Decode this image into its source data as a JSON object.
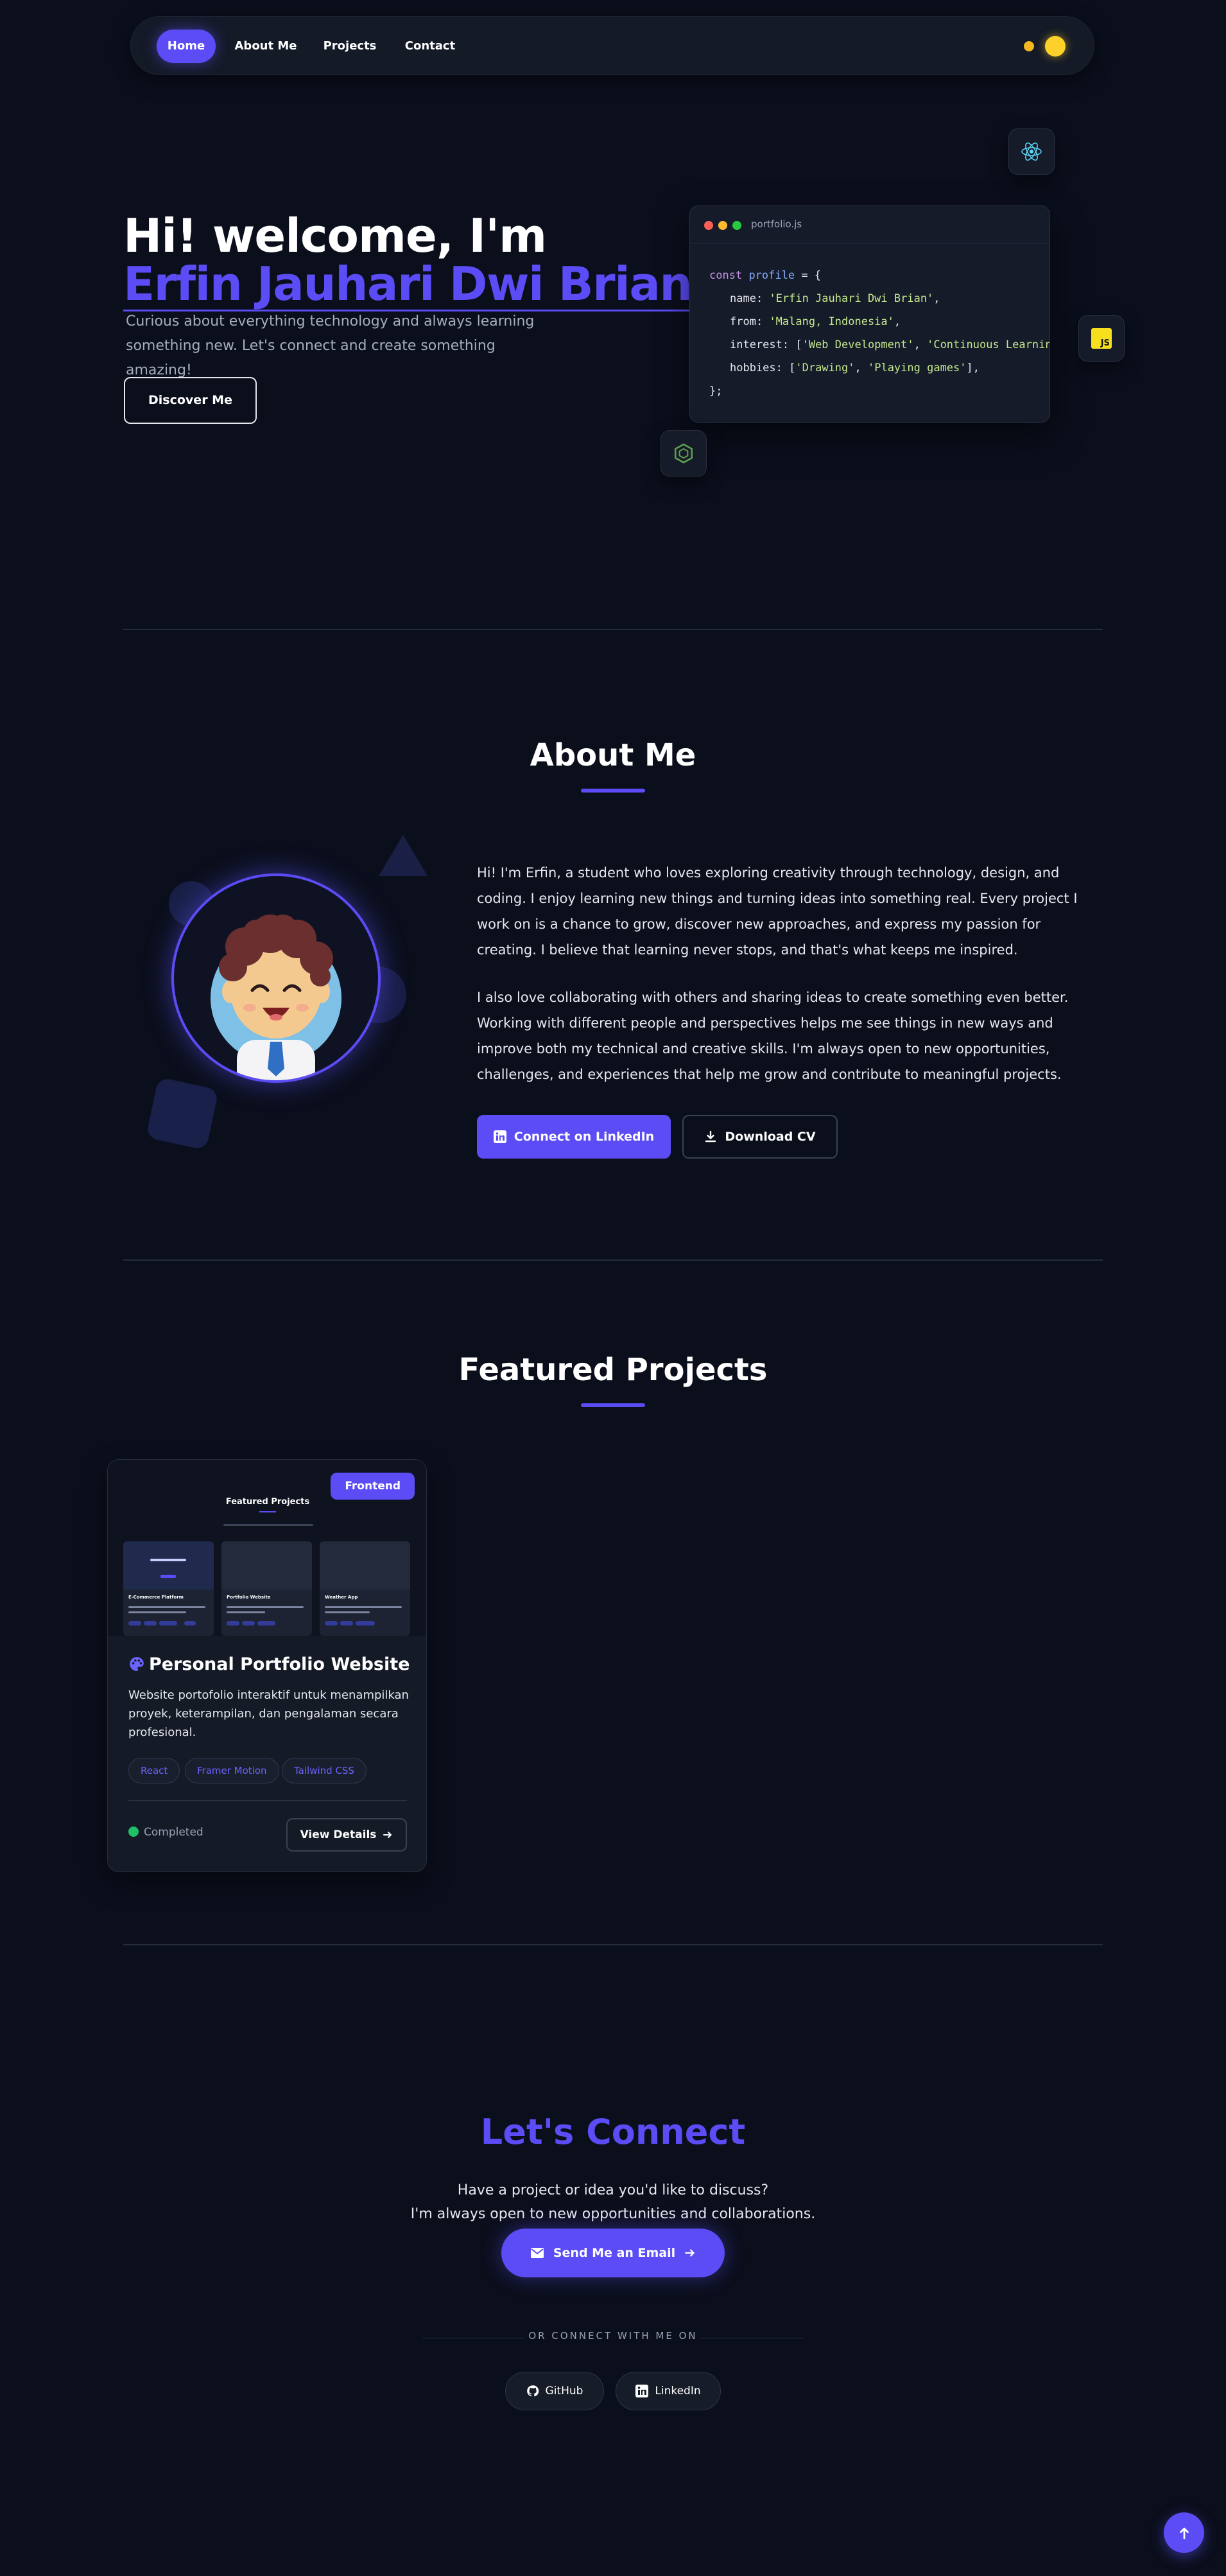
{
  "nav": {
    "items": [
      {
        "label": "Home",
        "active": true
      },
      {
        "label": "About Me",
        "active": false
      },
      {
        "label": "Projects",
        "active": false
      },
      {
        "label": "Contact",
        "active": false
      }
    ]
  },
  "hero": {
    "greeting": "Hi! welcome, I'm",
    "name": "Erfin Jauhari Dwi Brian",
    "description": "Curious about everything technology and always learning something new. Let's connect and create something amazing!",
    "cta_label": "Discover Me"
  },
  "code_card": {
    "filename": "portfolio.js",
    "line1_kw": "const",
    "line1_var": "profile",
    "line1_rest": " = {",
    "name_key": "name: ",
    "name_val": "'Erfin Jauhari Dwi Brian'",
    "from_key": "from: ",
    "from_val": "'Malang, Indonesia'",
    "interest_key": "interest: [",
    "interest_val1": "'Web Development'",
    "interest_val2": "'Continuous Learning'",
    "hobbies_key": "hobbies: [",
    "hobbies_val1": "'Drawing'",
    "hobbies_val2": "'Playing games'",
    "close": "};",
    "comma": ",",
    "arr_close": "],"
  },
  "chips": {
    "js_label": "JS"
  },
  "about": {
    "title": "About Me",
    "paragraph1": "Hi! I'm Erfin, a student who loves exploring creativity through technology, design, and coding. I enjoy learning new things and turning ideas into something real. Every project I work on is a chance to grow, discover new approaches, and express my passion for creating. I believe that learning never stops, and that's what keeps me inspired.",
    "paragraph2": "I also love collaborating with others and sharing ideas to create something even better. Working with different people and perspectives helps me see things in new ways and improve both my technical and creative skills. I'm always open to new opportunities, challenges, and experiences that help me grow and contribute to meaningful projects.",
    "linkedin_label": "Connect on LinkedIn",
    "cv_label": "Download CV"
  },
  "projects": {
    "title": "Featured Projects",
    "items": [
      {
        "badge": "Frontend",
        "title": "Personal Portfolio Website",
        "description": "Website portofolio interaktif untuk menampilkan proyek, keterampilan, dan pengalaman secara profesional.",
        "tags": [
          "React",
          "Framer Motion",
          "Tailwind CSS"
        ],
        "status": "Completed",
        "details_label": "View Details",
        "preview": {
          "heading": "Featured Projects",
          "cards": [
            "E-Commerce Platform",
            "Portfolio Website",
            "Weather App"
          ]
        }
      }
    ]
  },
  "connect": {
    "title": "Let's Connect",
    "line1": "Have a project or idea you'd like to discuss?",
    "line2": "I'm always open to new opportunities and collaborations.",
    "email_label": "Send Me an Email",
    "or_text": "OR CONNECT WITH ME ON",
    "github_label": "GitHub",
    "linkedin_label": "LinkedIn"
  },
  "colors": {
    "background": "#0b0f1c",
    "accent": "#5b4cf5",
    "surface": "#151a27",
    "success": "#1fbf6a"
  },
  "icons": [
    "react-icon",
    "js-icon",
    "node-icon",
    "linkedin-icon",
    "download-icon",
    "palette-icon",
    "arrow-right-icon",
    "mail-icon",
    "github-icon",
    "arrow-up-icon"
  ]
}
